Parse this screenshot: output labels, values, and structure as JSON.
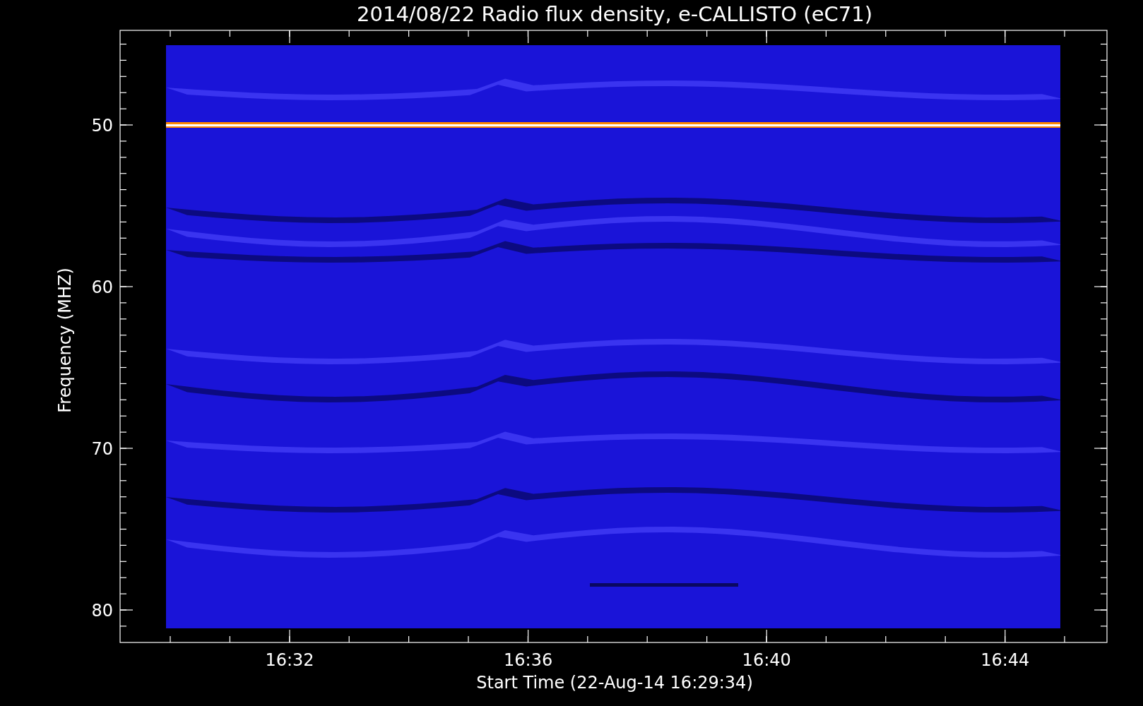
{
  "title": "2014/08/22  Radio flux density, e-CALLISTO (eC71)",
  "ylabel": "Frequency (MHZ)",
  "xlabel": "Start Time (22-Aug-14 16:29:34)",
  "yticks": [
    "50",
    "60",
    "70",
    "80"
  ],
  "xticks": [
    "16:32",
    "16:36",
    "16:40",
    "16:44"
  ]
}
